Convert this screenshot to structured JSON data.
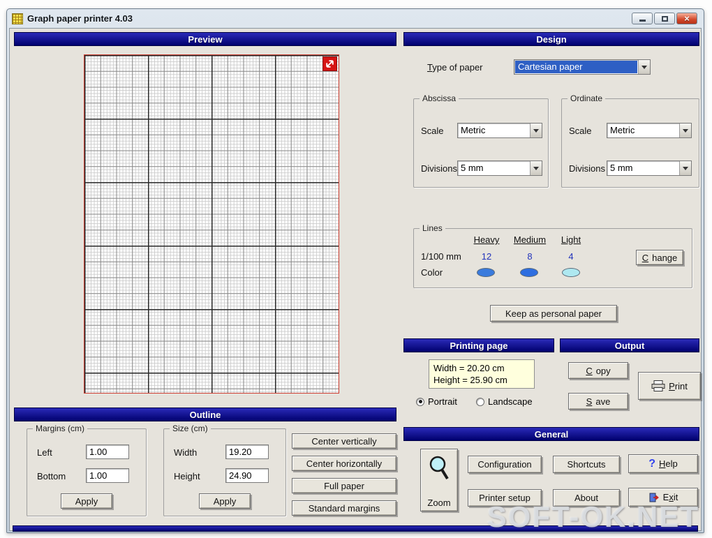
{
  "window": {
    "title": "Graph paper printer 4.03"
  },
  "panels": {
    "preview_header": "Preview",
    "outline_header": "Outline",
    "design_header": "Design",
    "printing_page_header": "Printing page",
    "output_header": "Output",
    "general_header": "General"
  },
  "outline": {
    "margins_group": "Margins (cm)",
    "left_label": "Left",
    "left_value": "1.00",
    "bottom_label": "Bottom",
    "bottom_value": "1.00",
    "margins_apply": "Apply",
    "size_group": "Size (cm)",
    "width_label": "Width",
    "width_value": "19.20",
    "height_label": "Height",
    "height_value": "24.90",
    "size_apply": "Apply",
    "center_vertically": "Center vertically",
    "center_horizontally": "Center horizontally",
    "full_paper": "Full paper",
    "standard_margins": "Standard margins"
  },
  "design": {
    "type_label": "Type of paper",
    "type_value": "Cartesian paper",
    "abscissa_group": "Abscissa",
    "ordinate_group": "Ordinate",
    "scale_label": "Scale",
    "abscissa_scale": "Metric",
    "ordinate_scale": "Metric",
    "divisions_label": "Divisions",
    "abscissa_divisions": "5 mm",
    "ordinate_divisions": "5 mm",
    "lines_group": "Lines",
    "heavy": "Heavy",
    "medium": "Medium",
    "light": "Light",
    "thickness_label": "1/100 mm",
    "heavy_value": "12",
    "medium_value": "8",
    "light_value": "4",
    "color_label": "Color",
    "colors": {
      "heavy": "#3a7bdd",
      "medium": "#2e6ee0",
      "light": "#aee8f0"
    },
    "change": "Change",
    "keep_button": "Keep as personal paper"
  },
  "printing": {
    "width_text": "Width = 20.20 cm",
    "height_text": "Height = 25.90 cm",
    "portrait": "Portrait",
    "landscape": "Landscape",
    "orientation": "portrait"
  },
  "output": {
    "copy": "Copy",
    "save": "Save",
    "print": "Print"
  },
  "general": {
    "zoom": "Zoom",
    "configuration": "Configuration",
    "shortcuts": "Shortcuts",
    "help": "Help",
    "printer_setup": "Printer setup",
    "about": "About",
    "exit": "Exit"
  },
  "icons": {
    "help": "?"
  },
  "watermark": "SOFT-OK.NET"
}
